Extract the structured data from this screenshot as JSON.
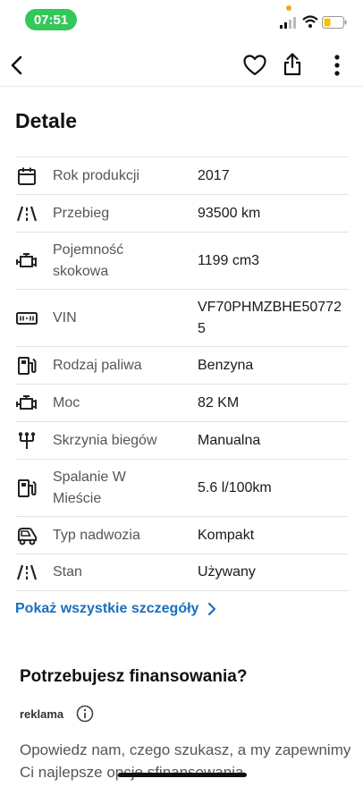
{
  "status_bar": {
    "time": "07:51"
  },
  "nav": {
    "back_icon": "chevron-left-icon",
    "favorite_icon": "heart-icon",
    "share_icon": "share-icon",
    "more_icon": "more-vertical-icon"
  },
  "details": {
    "title": "Detale",
    "rows": [
      {
        "icon": "calendar-icon",
        "label": "Rok produkcji",
        "value": "2017"
      },
      {
        "icon": "road-icon",
        "label": "Przebieg",
        "value": "93500 km"
      },
      {
        "icon": "engine-icon",
        "label": "Pojemność skokowa",
        "value": "1199 cm3"
      },
      {
        "icon": "vin-icon",
        "label": "VIN",
        "value": "VF70PHMZBHE507725"
      },
      {
        "icon": "fuel-icon",
        "label": "Rodzaj paliwa",
        "value": "Benzyna"
      },
      {
        "icon": "engine-icon",
        "label": "Moc",
        "value": "82 KM"
      },
      {
        "icon": "gearbox-icon",
        "label": "Skrzynia biegów",
        "value": "Manualna"
      },
      {
        "icon": "fuel-icon",
        "label": "Spalanie W Mieście",
        "value": "5.6 l/100km"
      },
      {
        "icon": "car-body-icon",
        "label": "Typ nadwozia",
        "value": "Kompakt"
      },
      {
        "icon": "road-icon",
        "label": "Stan",
        "value": "Używany"
      }
    ],
    "show_all": "Pokaż wszystkie szczegóły"
  },
  "financing": {
    "title": "Potrzebujesz finansowania?",
    "ad_label": "reklama",
    "text": "Opowiedz nam, czego szukasz, a my zapewnimy Ci najlepsze opcje sfinansowania"
  },
  "colors": {
    "accent": "#1a6fbf",
    "status_green": "#34c759"
  }
}
